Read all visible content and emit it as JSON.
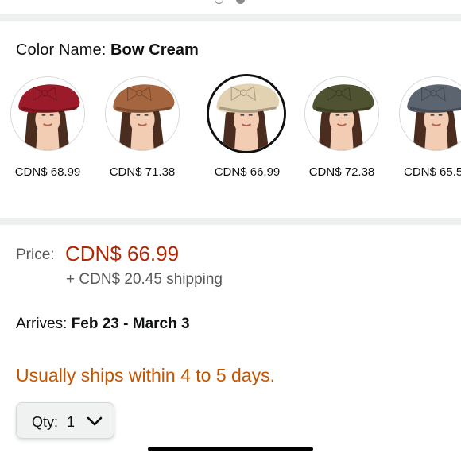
{
  "carousel": {
    "active_index": 2,
    "count": 2
  },
  "color": {
    "label": "Color Name: ",
    "selected_name": "Bow Cream"
  },
  "swatches": [
    {
      "price": "CDN$ 68.99",
      "color": "#9b1b2a",
      "selected": false
    },
    {
      "price": "CDN$ 71.38",
      "color": "#a5663f",
      "selected": false
    },
    {
      "price": "CDN$ 66.99",
      "color": "#e2d2b1",
      "selected": true
    },
    {
      "price": "CDN$ 72.38",
      "color": "#4f5331",
      "selected": false
    },
    {
      "price": "CDN$ 65.5",
      "color": "#5c6470",
      "selected": false
    }
  ],
  "pricing": {
    "label": "Price:",
    "value": "CDN$ 66.99",
    "shipping": "+ CDN$ 20.45 shipping"
  },
  "delivery": {
    "label": "Arrives: ",
    "dates": "Feb 23 - March 3"
  },
  "availability": "Usually ships within 4 to 5 days.",
  "quantity": {
    "label": "Qty:",
    "value": "1"
  },
  "colors": {
    "price_red": "#b12704",
    "availability_orange": "#c45500",
    "divider": "#eef0f0"
  }
}
